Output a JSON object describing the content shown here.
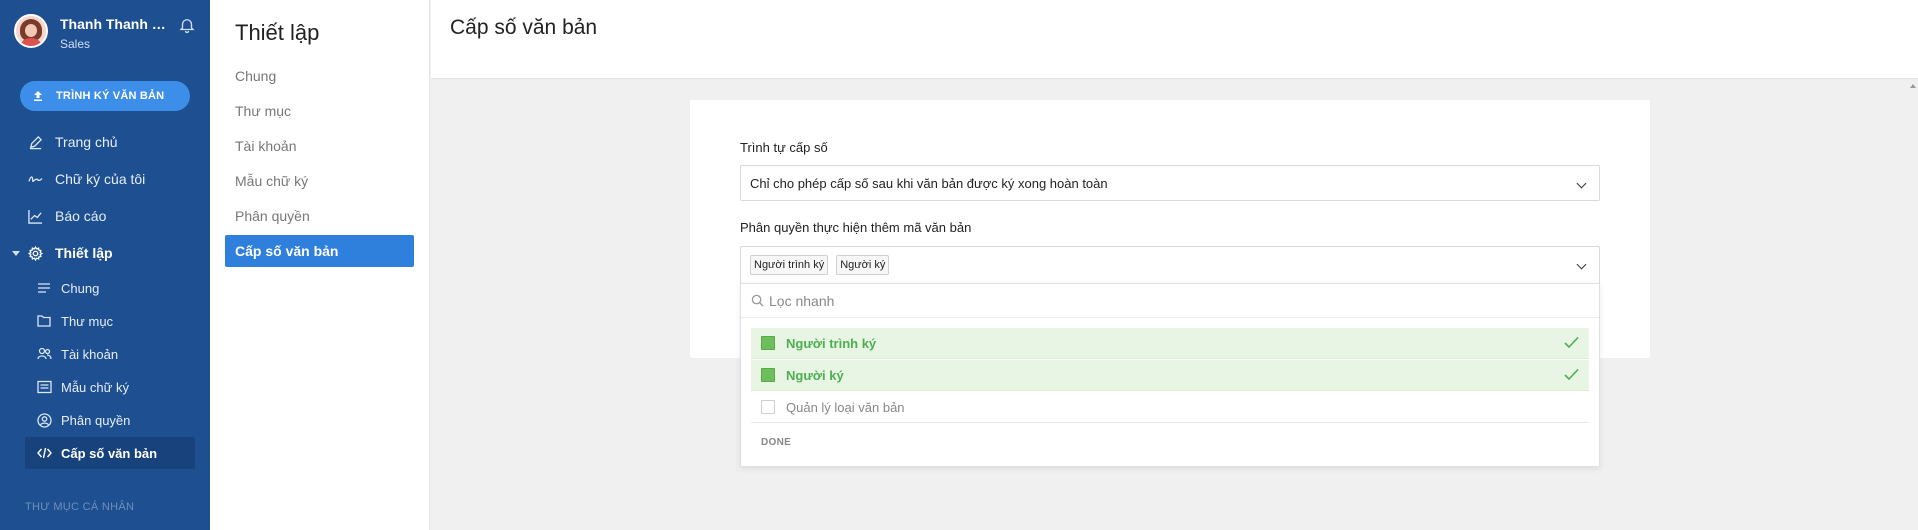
{
  "user": {
    "name": "Thanh Thanh Hoang",
    "role": "Sales"
  },
  "sidebar": {
    "sign_button": "TRÌNH KÝ VĂN BẢN",
    "nav": [
      {
        "label": "Trang chủ",
        "icon": "pen-icon"
      },
      {
        "label": "Chữ ký của tôi",
        "icon": "signature-icon"
      },
      {
        "label": "Báo cáo",
        "icon": "chart-icon"
      },
      {
        "label": "Thiết lập",
        "icon": "gear-icon"
      }
    ],
    "sub": [
      {
        "label": "Chung",
        "icon": "list-icon"
      },
      {
        "label": "Thư mục",
        "icon": "folder-icon"
      },
      {
        "label": "Tài khoản",
        "icon": "users-icon"
      },
      {
        "label": "Mẫu chữ ký",
        "icon": "template-icon"
      },
      {
        "label": "Phân quyền",
        "icon": "user-circle-icon"
      },
      {
        "label": "Cấp số văn bản",
        "icon": "code-icon"
      }
    ],
    "section": "THƯ MỤC CÁ NHÂN"
  },
  "settings": {
    "title": "Thiết lập",
    "items": [
      "Chung",
      "Thư mục",
      "Tài khoản",
      "Mẫu chữ ký",
      "Phân quyền",
      "Cấp số văn bản"
    ]
  },
  "main": {
    "title": "Cấp số văn bản",
    "sequence_label": "Trình tự cấp số",
    "sequence_value": "Chỉ cho phép cấp số sau khi văn bản được ký xong hoàn toàn",
    "permission_label": "Phân quyền thực hiện thêm mã văn bản",
    "tags": [
      "Người trình ký",
      "Người ký"
    ],
    "filter_placeholder": "Lọc nhanh",
    "options": [
      {
        "label": "Người trình ký",
        "selected": true
      },
      {
        "label": "Người ký",
        "selected": true
      },
      {
        "label": "Quản lý loại văn bản",
        "selected": false
      }
    ],
    "done_label": "DONE"
  },
  "colors": {
    "sidebar": "#1d4f91",
    "accent": "#2f7fdc",
    "selected_green": "#4caf50"
  }
}
